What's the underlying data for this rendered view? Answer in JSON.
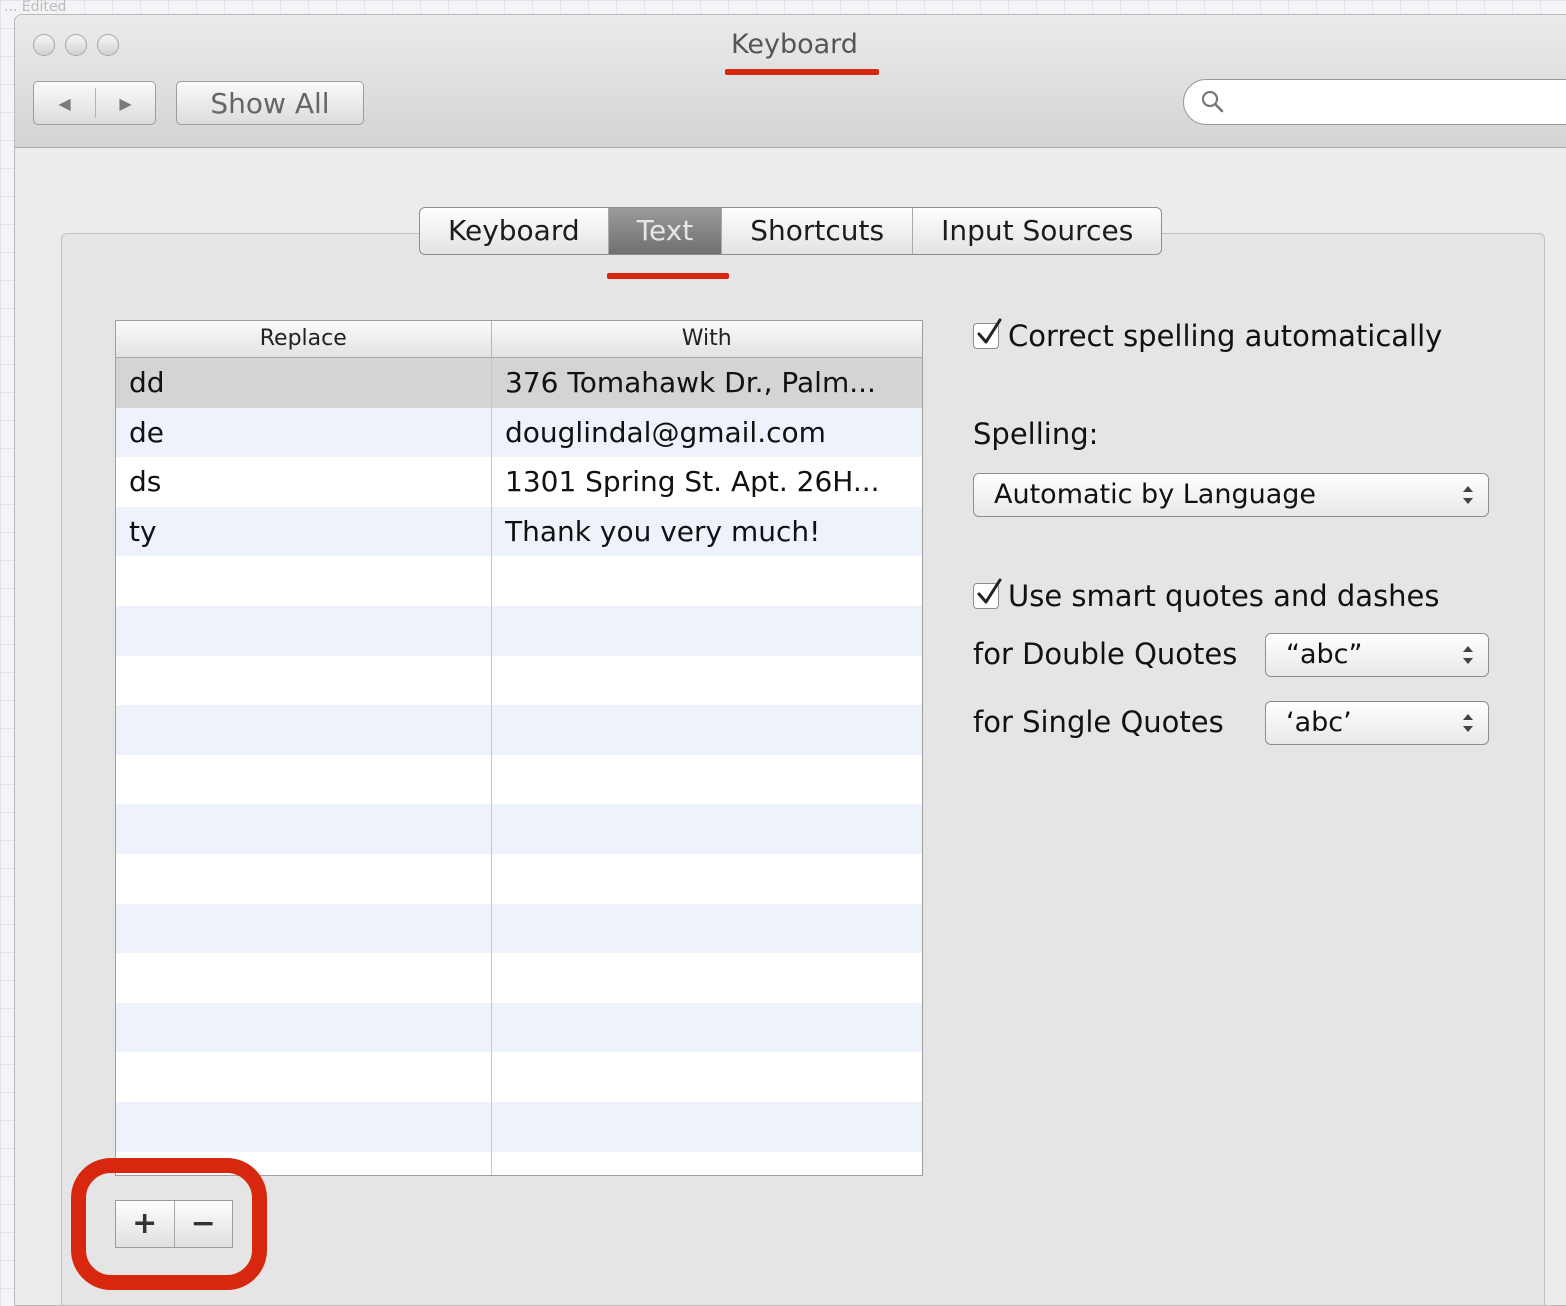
{
  "window": {
    "title": "Keyboard",
    "background_fragment": "...  Edited"
  },
  "toolbar": {
    "back_label": "◀",
    "forward_label": "▶",
    "show_all_label": "Show All",
    "search_value": "",
    "search_placeholder": ""
  },
  "tabs": [
    {
      "label": "Keyboard",
      "active": false
    },
    {
      "label": "Text",
      "active": true
    },
    {
      "label": "Shortcuts",
      "active": false
    },
    {
      "label": "Input Sources",
      "active": false
    }
  ],
  "replacements": {
    "columns": [
      "Replace",
      "With"
    ],
    "rows": [
      {
        "replace": "dd",
        "with": "376 Tomahawk Dr., Palm...",
        "selected": true
      },
      {
        "replace": "de",
        "with": "douglindal@gmail.com",
        "selected": false
      },
      {
        "replace": "ds",
        "with": "1301 Spring St. Apt. 26H...",
        "selected": false
      },
      {
        "replace": "ty",
        "with": "Thank you very much!",
        "selected": false
      },
      {
        "replace": "",
        "with": ""
      },
      {
        "replace": "",
        "with": ""
      },
      {
        "replace": "",
        "with": ""
      },
      {
        "replace": "",
        "with": ""
      },
      {
        "replace": "",
        "with": ""
      },
      {
        "replace": "",
        "with": ""
      },
      {
        "replace": "",
        "with": ""
      },
      {
        "replace": "",
        "with": ""
      },
      {
        "replace": "",
        "with": ""
      },
      {
        "replace": "",
        "with": ""
      },
      {
        "replace": "",
        "with": ""
      },
      {
        "replace": "",
        "with": ""
      }
    ],
    "add_label": "+",
    "remove_label": "−"
  },
  "options": {
    "correct_spelling": {
      "label": "Correct spelling automatically",
      "checked": true
    },
    "spelling_label": "Spelling:",
    "spelling_value": "Automatic by Language",
    "smart_quotes": {
      "label": "Use smart quotes and dashes",
      "checked": true
    },
    "double_quotes_label": "for Double Quotes",
    "double_quotes_value": "“abc”",
    "single_quotes_label": "for Single Quotes",
    "single_quotes_value": "‘abc’"
  },
  "colors": {
    "annotation_red": "#d7280f",
    "active_tab": "#7f7f7f",
    "selected_row": "#d4d4d4",
    "alt_row": "#eef3fb"
  },
  "icons": {
    "search": "magnifier-icon",
    "checkbox": "check-mark-icon",
    "popup": "updown-arrows-icon"
  }
}
